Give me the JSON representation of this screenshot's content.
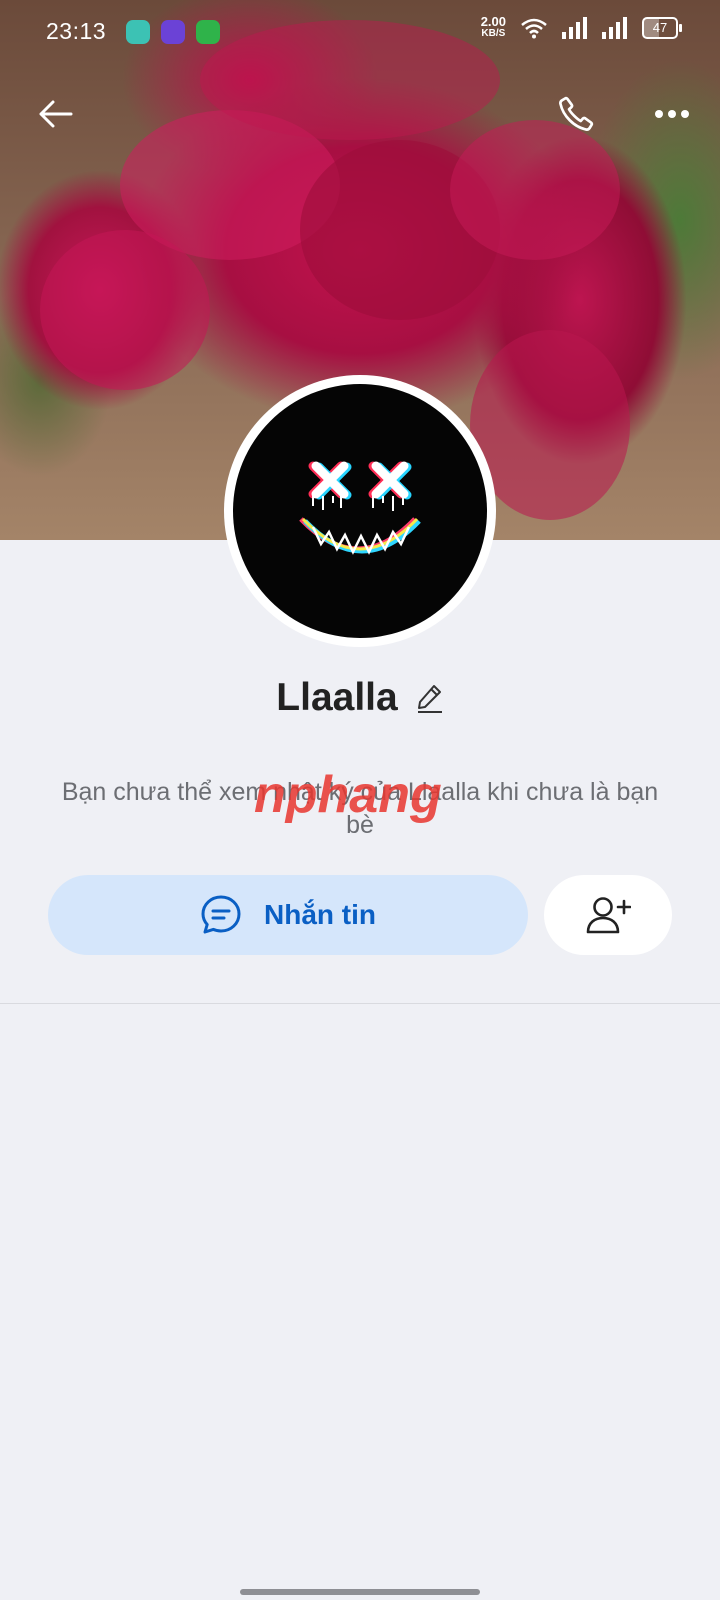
{
  "status_bar": {
    "time": "23:13",
    "speed_value": "2.00",
    "speed_unit": "KB/S",
    "battery": "47",
    "battery_level": 0.47,
    "app_icons": [
      {
        "name": "chat-app-icon",
        "color": "#3cc2b4"
      },
      {
        "name": "loop-app-icon",
        "color": "#6b42d6"
      },
      {
        "name": "shield-app-icon",
        "color": "#2fb34a"
      }
    ]
  },
  "header": {
    "back_icon": "arrow-left-icon",
    "call_icon": "phone-icon",
    "more_icon": "more-dots-icon"
  },
  "profile": {
    "name": "Llaalla",
    "edit_icon": "pencil-icon",
    "notice": "Bạn chưa thể xem nhật ký của Llaalla khi chưa là bạn bè"
  },
  "actions": {
    "message_label": "Nhắn tin",
    "message_icon": "chat-bubble-icon",
    "add_friend_icon": "add-friend-icon"
  },
  "watermark": {
    "text": "nphang"
  },
  "colors": {
    "accent": "#0a5fc4",
    "message_button_bg": "#d5e6fb",
    "page_bg": "#eff0f5"
  }
}
